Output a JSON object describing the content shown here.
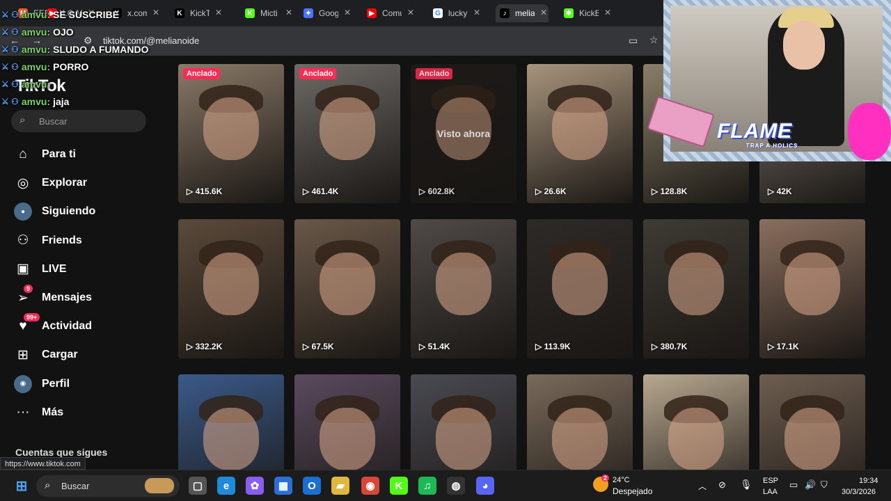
{
  "tabs": [
    {
      "title": "EEEEEE",
      "icon": "gmail-icon",
      "color": "#e8592d",
      "glyph": "M"
    },
    {
      "title": "LO M",
      "icon": "youtube-icon",
      "color": "#ff0000",
      "glyph": "▶"
    },
    {
      "title": "x.com",
      "icon": "x-icon",
      "color": "#000000",
      "glyph": "X"
    },
    {
      "title": "KickT",
      "icon": "kick-icon",
      "color": "#000000",
      "glyph": "K"
    },
    {
      "title": "Micti",
      "icon": "kick-green-icon",
      "color": "#53fc18",
      "glyph": "K"
    },
    {
      "title": "Goog",
      "icon": "gemini-icon",
      "color": "#4a72ff",
      "glyph": "✦"
    },
    {
      "title": "Comu",
      "icon": "youtube-icon",
      "color": "#ff0000",
      "glyph": "▶"
    },
    {
      "title": "lucky",
      "icon": "google-icon",
      "color": "#ffffff",
      "glyph": "G"
    },
    {
      "title": "melia",
      "icon": "tiktok-icon",
      "color": "#000000",
      "glyph": "♪"
    },
    {
      "title": "KickB",
      "icon": "kick-bot-icon",
      "color": "#53fc18",
      "glyph": "✱"
    }
  ],
  "address": {
    "url": "tiktok.com/@melianoide"
  },
  "chat": [
    {
      "user": "amvu",
      "text": "SE SUSCRIBE"
    },
    {
      "user": "amvu",
      "text": "OJO"
    },
    {
      "user": "amvu",
      "text": "SLUDO A FUMANDO"
    },
    {
      "user": "amvu",
      "text": "PORRO"
    },
    {
      "user": "amvu",
      "text": ""
    },
    {
      "user": "amvu",
      "text": "jaja"
    }
  ],
  "sidebar": {
    "logo": "TikTok",
    "search_placeholder": "Buscar",
    "items": [
      {
        "label": "Para ti",
        "icon": "home-icon",
        "glyph": "⌂"
      },
      {
        "label": "Explorar",
        "icon": "compass-icon",
        "glyph": "◎"
      },
      {
        "label": "Siguiendo",
        "icon": "following-avatar-icon",
        "glyph": "●"
      },
      {
        "label": "Friends",
        "icon": "friends-icon",
        "glyph": "⚇"
      },
      {
        "label": "LIVE",
        "icon": "live-icon",
        "glyph": "▣"
      },
      {
        "label": "Mensajes",
        "icon": "messages-icon",
        "glyph": "➢",
        "badge": "9"
      },
      {
        "label": "Actividad",
        "icon": "activity-icon",
        "glyph": "♥",
        "badge": "99+"
      },
      {
        "label": "Cargar",
        "icon": "upload-icon",
        "glyph": "⊞"
      },
      {
        "label": "Perfil",
        "icon": "profile-avatar-icon",
        "glyph": "◉"
      },
      {
        "label": "Más",
        "icon": "more-icon",
        "glyph": "···"
      }
    ],
    "following_header": "Cuentas que sigues"
  },
  "status_url": "https://www.tiktok.com",
  "videos": [
    {
      "views": "415.6K",
      "pinned": true,
      "label": "Anclado",
      "bg": "#8a7a68"
    },
    {
      "views": "461.4K",
      "pinned": true,
      "label": "Anclado",
      "bg": "#6e6a66"
    },
    {
      "views": "602.8K",
      "pinned": true,
      "label": "Anclado",
      "bg": "#1f1c1a",
      "watched": "Visto ahora"
    },
    {
      "views": "26.6K",
      "pinned": false,
      "bg": "#a8947c"
    },
    {
      "views": "128.8K",
      "pinned": false,
      "bg": "#8a7f68"
    },
    {
      "views": "42K",
      "pinned": false,
      "bg": "#807870"
    },
    {
      "views": "332.2K",
      "pinned": false,
      "bg": "#5b4a3a"
    },
    {
      "views": "67.5K",
      "pinned": false,
      "bg": "#6a5848"
    },
    {
      "views": "51.4K",
      "pinned": false,
      "bg": "#4f4a48"
    },
    {
      "views": "113.9K",
      "pinned": false,
      "bg": "#2d2a28"
    },
    {
      "views": "380.7K",
      "pinned": false,
      "bg": "#3e3a34"
    },
    {
      "views": "17.1K",
      "pinned": false,
      "bg": "#8a6f5e"
    },
    {
      "views": "",
      "pinned": false,
      "bg": "#3a5a8a"
    },
    {
      "views": "",
      "pinned": false,
      "bg": "#5a4a5e"
    },
    {
      "views": "",
      "pinned": false,
      "bg": "#4a4a52"
    },
    {
      "views": "",
      "pinned": false,
      "bg": "#7a6a5a"
    },
    {
      "views": "",
      "pinned": false,
      "bg": "#b8a890"
    },
    {
      "views": "",
      "pinned": false,
      "bg": "#6e5e50"
    }
  ],
  "overlay": {
    "flame": "FLAME",
    "sub": "TRAP A HOLICS"
  },
  "taskbar": {
    "search": "Buscar",
    "weather_temp": "24°C",
    "weather_desc": "Despejado",
    "weather_badge": "2",
    "lang1": "ESP",
    "lang2": "LAA",
    "time": "19:34",
    "date": "30/3/2026",
    "apps": [
      {
        "icon": "taskview-icon",
        "glyph": "▢",
        "color": "#555555"
      },
      {
        "icon": "edge-icon",
        "glyph": "e",
        "color": "#1f8ad8"
      },
      {
        "icon": "copilot-icon",
        "glyph": "✿",
        "color": "#8a5cf6"
      },
      {
        "icon": "store-icon",
        "glyph": "▦",
        "color": "#2b6fd6"
      },
      {
        "icon": "outlook-icon",
        "glyph": "O",
        "color": "#1a6fd1"
      },
      {
        "icon": "folder-icon",
        "glyph": "▰",
        "color": "#e0b840"
      },
      {
        "icon": "chrome-icon",
        "glyph": "◉",
        "color": "#d8463a"
      },
      {
        "icon": "kick-icon",
        "glyph": "K",
        "color": "#53fc18"
      },
      {
        "icon": "spotify-icon",
        "glyph": "♫",
        "color": "#1db954"
      },
      {
        "icon": "obs-icon",
        "glyph": "◍",
        "color": "#333333"
      },
      {
        "icon": "discord-icon",
        "glyph": "◕",
        "color": "#5865f2"
      }
    ]
  }
}
